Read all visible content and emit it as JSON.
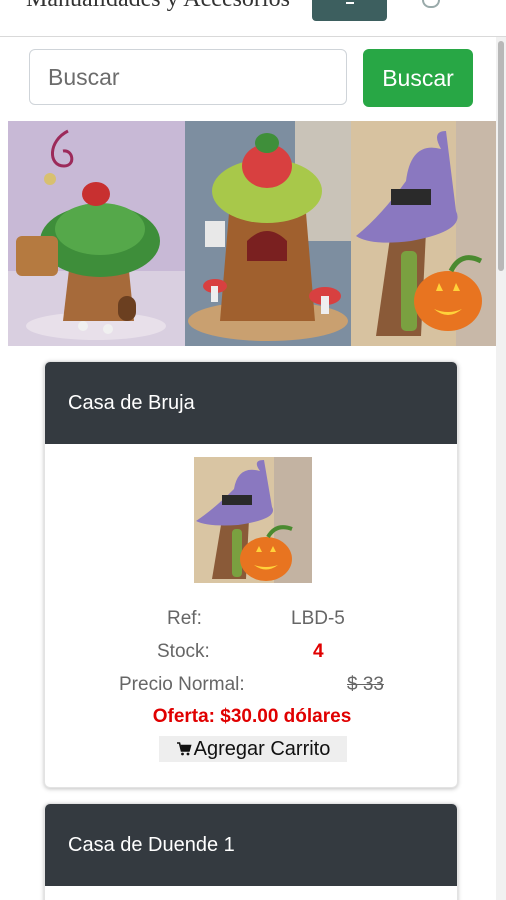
{
  "header": {
    "brand": "Manualidades y Accesorios"
  },
  "search": {
    "placeholder": "Buscar",
    "button_label": "Buscar"
  },
  "products": [
    {
      "name": "Casa de Bruja",
      "ref_label": "Ref:",
      "ref_value": "LBD-5",
      "stock_label": "Stock:",
      "stock_value": "4",
      "price_label": "Precio Normal:",
      "price_value": "$ 33",
      "offer_text": "Oferta: $30.00 dólares",
      "cart_label": "Agregar Carrito"
    },
    {
      "name": "Casa de Duende 1"
    }
  ],
  "icons": {
    "cart": "shopping-cart-icon"
  },
  "colors": {
    "search_button": "#28a745",
    "card_header": "#343a40",
    "offer": "#e00000",
    "stock": "#e00000",
    "toggler": "#3d5f5f"
  }
}
